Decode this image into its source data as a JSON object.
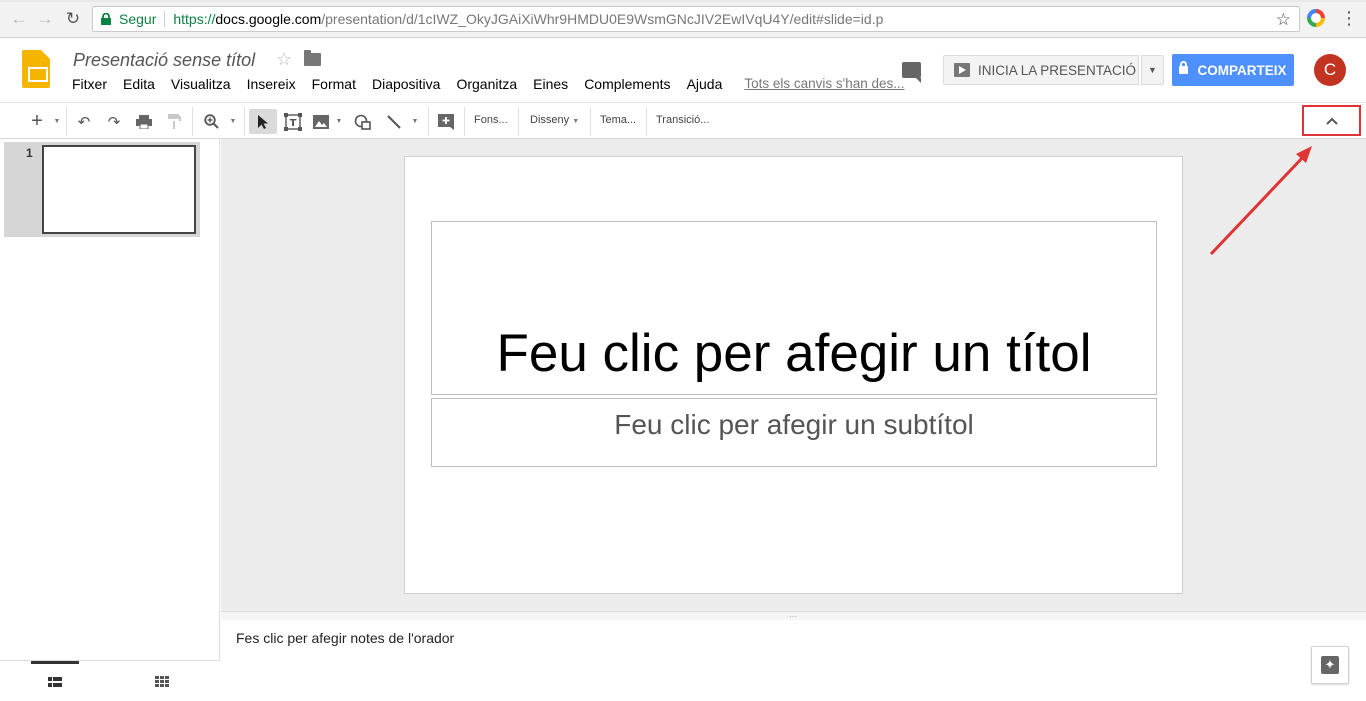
{
  "browser": {
    "secure_label": "Segur",
    "url_scheme": "https://",
    "url_host": "docs.google.com",
    "url_path": "/presentation/d/1cIWZ_OkyJGAiXiWhr9HMDU0E9WsmGNcJIV2EwIVqU4Y/edit#slide=id.p"
  },
  "app": {
    "doc_title": "Presentació sense títol",
    "menus": [
      "Fitxer",
      "Edita",
      "Visualitza",
      "Insereix",
      "Format",
      "Diapositiva",
      "Organitza",
      "Eines",
      "Complements",
      "Ajuda"
    ],
    "last_edit": "Tots els canvis s'han des...",
    "present_label": "INICIA LA PRESENTACIÓ",
    "share_label": "COMPARTEIX",
    "avatar_initial": "C"
  },
  "toolbar": {
    "background_label": "Fons...",
    "layout_label": "Disseny",
    "theme_label": "Tema...",
    "transition_label": "Transició..."
  },
  "filmstrip": {
    "slide_number": "1"
  },
  "slide": {
    "title_placeholder": "Feu clic per afegir un títol",
    "subtitle_placeholder": "Feu clic per afegir un subtítol"
  },
  "notes": {
    "placeholder": "Fes clic per afegir notes de l'orador"
  },
  "colors": {
    "share_blue": "#4d90fe",
    "slides_yellow": "#f4b400",
    "avatar_red": "#c23321",
    "annotation_red": "#e03434"
  },
  "icons": [
    "back-icon",
    "forward-icon",
    "reload-icon",
    "lock-icon",
    "bookmark-star-icon",
    "chrome-menu-icon",
    "slides-logo-icon",
    "star-icon",
    "folder-icon",
    "comment-icon",
    "play-icon",
    "share-lock-icon",
    "new-slide-icon",
    "undo-icon",
    "redo-icon",
    "print-icon",
    "paint-format-icon",
    "zoom-icon",
    "select-cursor-icon",
    "textbox-icon",
    "image-icon",
    "shape-icon",
    "line-icon",
    "comment-add-icon",
    "chevron-up-icon",
    "list-view-icon",
    "grid-view-icon",
    "explore-icon"
  ]
}
